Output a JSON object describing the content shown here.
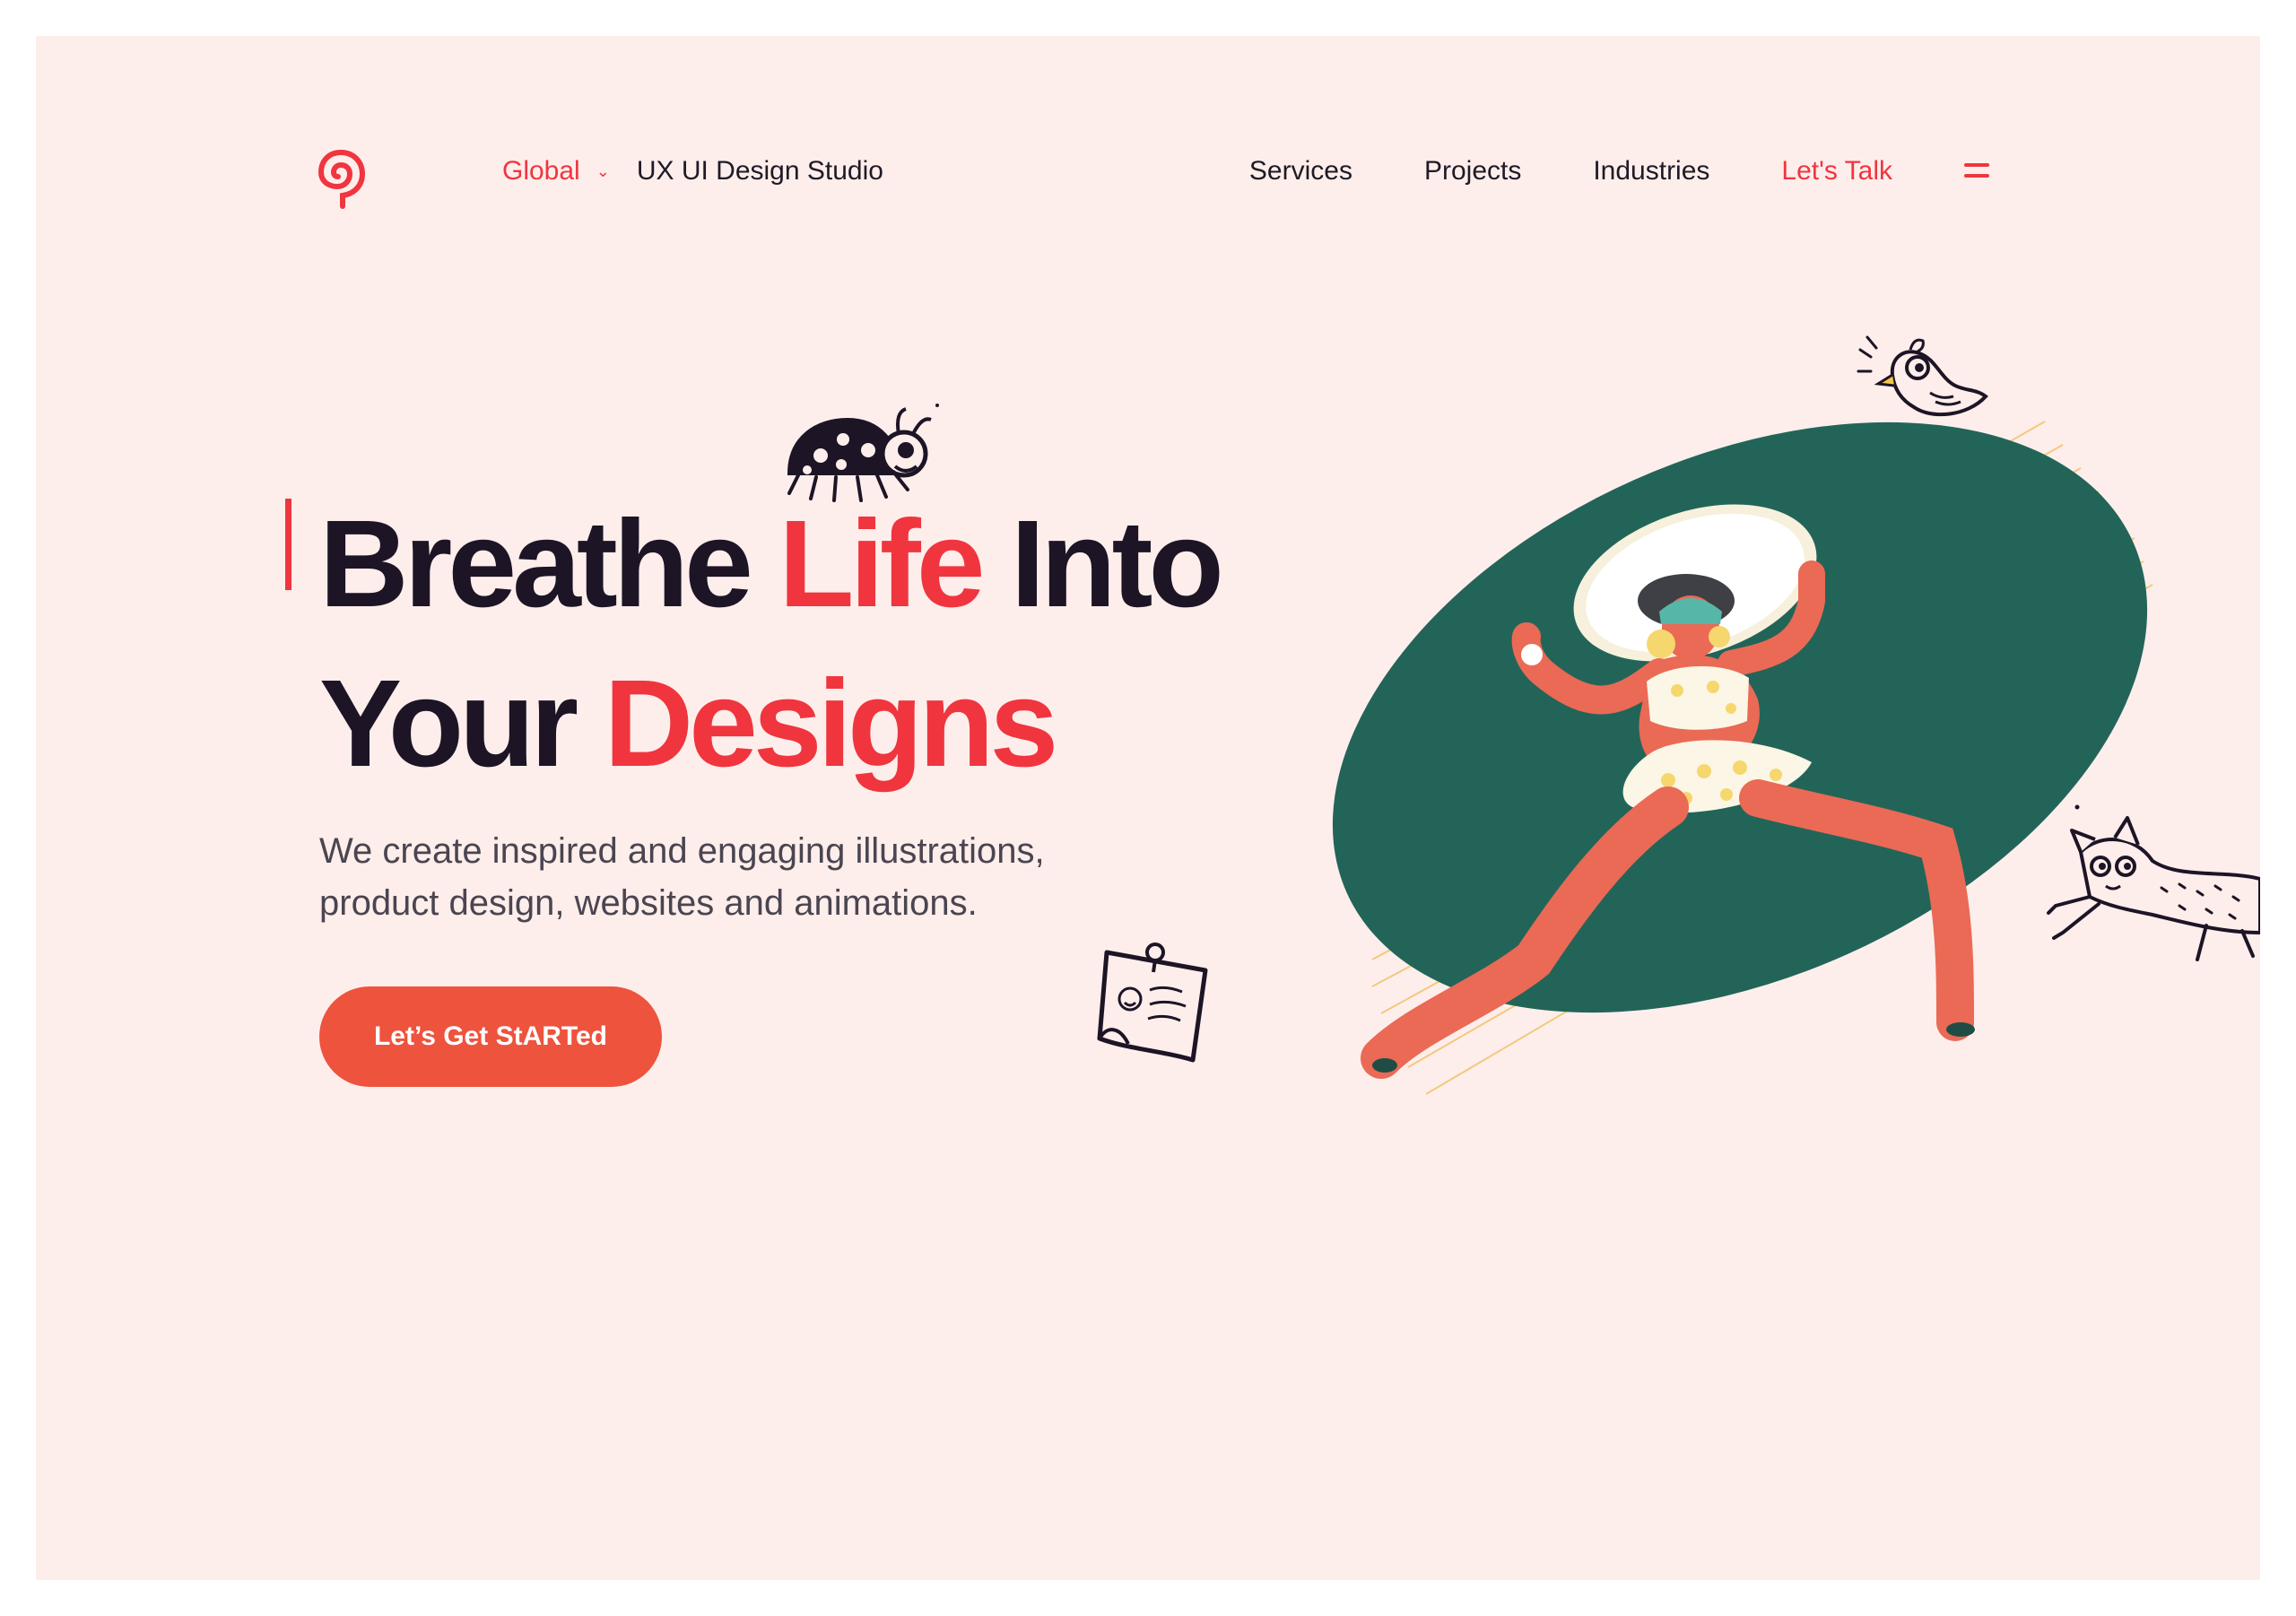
{
  "header": {
    "logo_icon": "spiral-lollipop-logo",
    "region_label": "Global",
    "region_icon": "chevron-down-icon",
    "tagline": "UX UI Design Studio",
    "nav": [
      {
        "label": "Services"
      },
      {
        "label": "Projects"
      },
      {
        "label": "Industries"
      },
      {
        "label": "Let's Talk"
      }
    ],
    "menu_icon": "menu-icon"
  },
  "hero": {
    "title_part1": "Breathe ",
    "title_highlight1": "Life",
    "title_part2": " Into",
    "title_part3": "Your ",
    "title_highlight2": "Designs",
    "subtitle_line1": "We create inspired and engaging illustrations,",
    "subtitle_line2": "product design, websites and animations.",
    "cta_label": "Let’s  Get StARTed"
  },
  "illustrations": {
    "ladybug": "ladybug-doodle",
    "bird": "bird-doodle",
    "note": "pinned-note-doodle",
    "cat": "flying-cat-doodle",
    "main": "dancing-woman-with-sun-hat"
  },
  "colors": {
    "background": "#fdeeeb",
    "accent": "#f0353f",
    "cta": "#ee533d",
    "text_dark": "#1d1526",
    "ellipse_green": "#236459",
    "skin": "#ea6a55"
  }
}
